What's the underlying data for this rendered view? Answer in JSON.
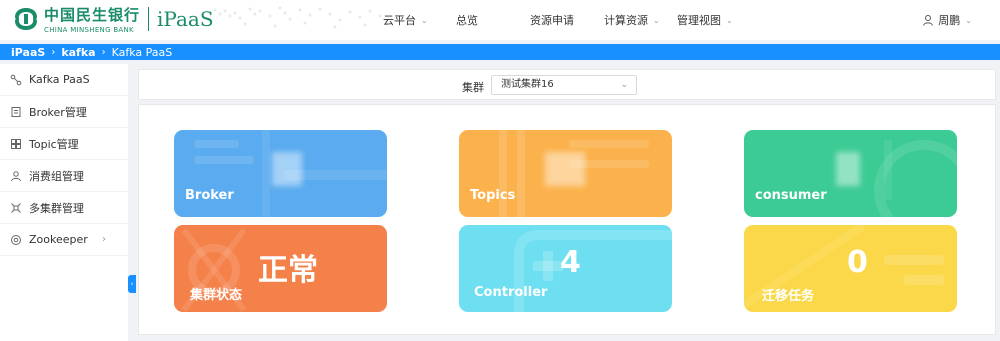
{
  "header": {
    "bank_name_cn": "中国民生银行",
    "bank_name_en": "CHINA MINSHENG BANK",
    "product": "iPaaS",
    "nav": [
      {
        "label": "云平台",
        "has_dropdown": true
      },
      {
        "label": "总览",
        "has_dropdown": false
      },
      {
        "label": "资源申请",
        "has_dropdown": false
      },
      {
        "label": "计算资源",
        "has_dropdown": true
      },
      {
        "label": "管理视图",
        "has_dropdown": true
      }
    ],
    "user": "周鹏"
  },
  "breadcrumb": [
    "iPaaS",
    "kafka",
    "Kafka PaaS"
  ],
  "sidebar": {
    "items": [
      {
        "label": "Kafka PaaS",
        "icon": "nodes-icon"
      },
      {
        "label": "Broker管理",
        "icon": "document-icon"
      },
      {
        "label": "Topic管理",
        "icon": "grid-icon"
      },
      {
        "label": "消费组管理",
        "icon": "users-icon"
      },
      {
        "label": "多集群管理",
        "icon": "cluster-icon"
      },
      {
        "label": "Zookeeper",
        "icon": "circle-icon",
        "has_submenu": true
      }
    ]
  },
  "filter": {
    "label": "集群",
    "selected": "测试集群16"
  },
  "cards": {
    "broker": {
      "label": "Broker",
      "color": "#5aabef"
    },
    "topics": {
      "label": "Topics",
      "color": "#fbb24d"
    },
    "consumer": {
      "label": "consumer",
      "color": "#3ccb94"
    },
    "status": {
      "value": "正常",
      "label": "集群状态",
      "color": "#f5814a"
    },
    "controller": {
      "value": "4",
      "label": "Controller",
      "color": "#6ddff0"
    },
    "migration": {
      "value": "0",
      "label": "迁移任务",
      "color": "#fbd84a"
    }
  },
  "colors": {
    "brand_green": "#1a8c6a",
    "accent_blue": "#1890ff"
  }
}
